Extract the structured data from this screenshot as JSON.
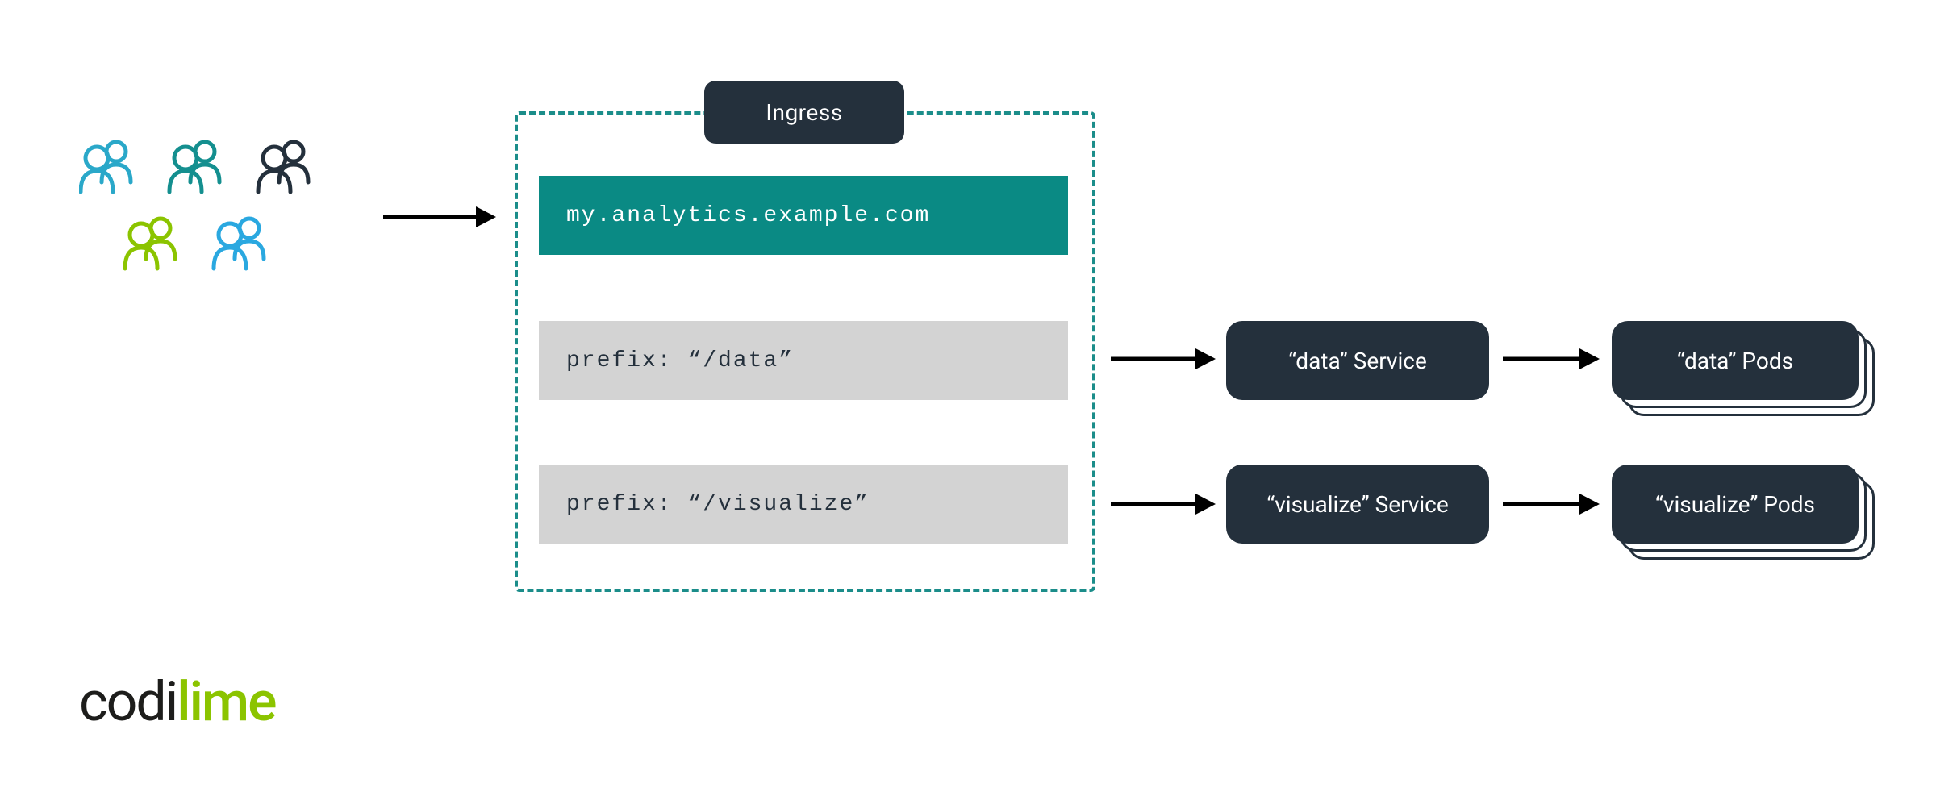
{
  "ingress": {
    "label": "Ingress",
    "host": "my.analytics.example.com",
    "rules": [
      {
        "prefix_label": "prefix: “/data”"
      },
      {
        "prefix_label": "prefix: “/visualize”"
      }
    ]
  },
  "services": [
    {
      "label": "“data” Service"
    },
    {
      "label": "“visualize” Service"
    }
  ],
  "pods": [
    {
      "label": "“data” Pods"
    },
    {
      "label": "“visualize” Pods"
    }
  ],
  "logo": {
    "part1": "codi",
    "part2": "lime"
  },
  "colors": {
    "dark": "#24303c",
    "teal_border": "#1b8d8a",
    "teal_fill": "#0a8a84",
    "grey": "#d3d3d3",
    "lime": "#8bc400",
    "cyan": "#2aa8c9",
    "teal_icon": "#148f8f",
    "blue_icon": "#2aa8e0"
  }
}
